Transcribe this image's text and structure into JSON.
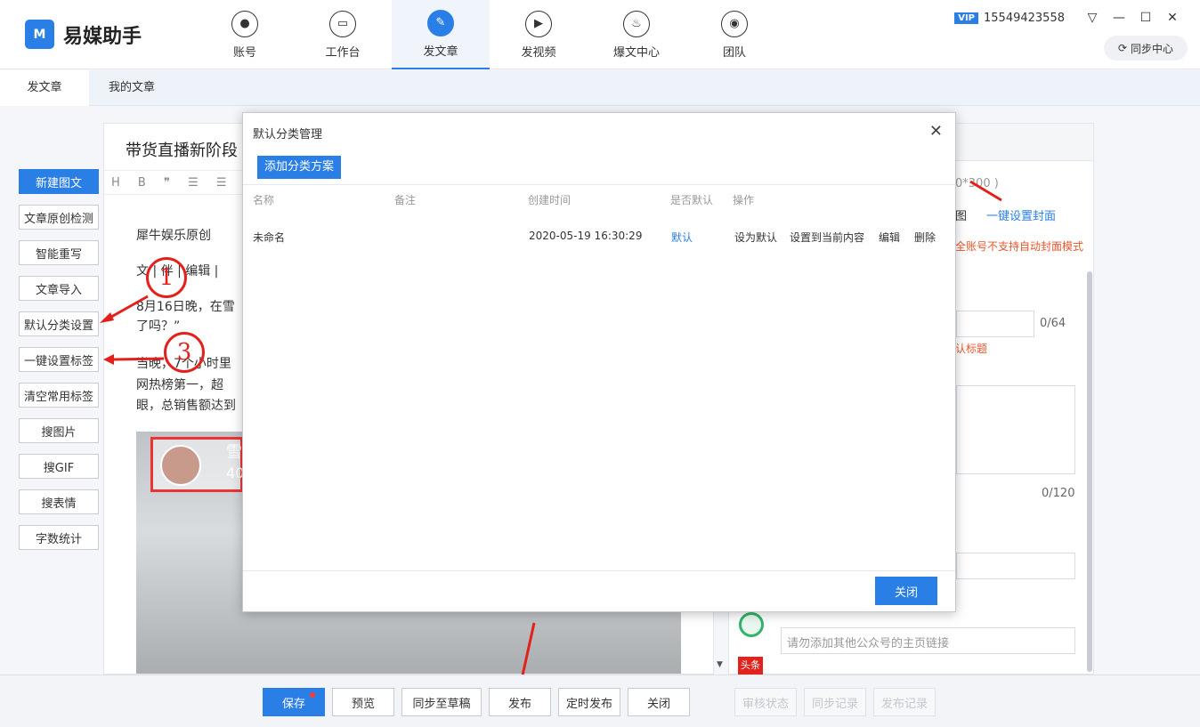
{
  "app": {
    "name": "易媒助手",
    "logo_glyph": "M"
  },
  "nav": [
    {
      "label": "账号",
      "icon": "person-icon",
      "glyph": "●"
    },
    {
      "label": "工作台",
      "icon": "monitor-icon",
      "glyph": "▭"
    },
    {
      "label": "发文章",
      "icon": "feather-icon",
      "glyph": "✎"
    },
    {
      "label": "发视频",
      "icon": "play-icon",
      "glyph": "▶"
    },
    {
      "label": "爆文中心",
      "icon": "flame-icon",
      "glyph": "♨"
    },
    {
      "label": "团队",
      "icon": "team-icon",
      "glyph": "◉"
    }
  ],
  "user": {
    "vip": "VIP",
    "phone": "15549423558"
  },
  "sync_center": "同步中心",
  "subtabs": [
    "发文章",
    "我的文章"
  ],
  "left_buttons": [
    "新建图文",
    "文章原创检测",
    "智能重写",
    "文章导入",
    "默认分类设置",
    "一键设置标签",
    "清空常用标签",
    "搜图片",
    "搜GIF",
    "搜表情",
    "字数统计"
  ],
  "editor": {
    "title": "带货直播新阶段",
    "toolbar": "H B ❞ ☰ ☰ —",
    "lines": [
      "犀牛娱乐原创",
      "文 | 伴 | 编辑 | ",
      "8月16日晚，在雪",
      "了吗？”",
      "当晚，7个小时里",
      "网热榜第一，超",
      "眼，总销售额达到"
    ],
    "image_text": [
      "雪",
      "40"
    ]
  },
  "right_panel": {
    "size_hint": "0*300 )",
    "cover_link": "一键设置封面",
    "cover_note": "全账号不支持自动封面模式",
    "title_count": "0/64",
    "title_hint": "认标题",
    "abstract_count": "0/120",
    "link_placeholder": "请勿添加其他公众号的主页链接",
    "tu": "图"
  },
  "modal": {
    "title": "默认分类管理",
    "add_button": "添加分类方案",
    "columns": [
      "名称",
      "备注",
      "创建时间",
      "是否默认",
      "操作"
    ],
    "rows": [
      {
        "name": "未命名",
        "note": "",
        "created": "2020-05-19 16:30:29",
        "is_default": "默认",
        "ops": [
          "设为默认",
          "设置到当前内容",
          "编辑",
          "删除"
        ]
      }
    ],
    "close_button": "关闭"
  },
  "bottom": {
    "save": "保存",
    "preview": "预览",
    "sync_draft": "同步至草稿",
    "publish": "发布",
    "schedule": "定时发布",
    "close": "关闭",
    "audit": "审核状态",
    "sync_log": "同步记录",
    "publish_log": "发布记录"
  },
  "annotations": [
    "1",
    "3"
  ],
  "colors": {
    "accent": "#2a7fe6",
    "annotation": "#e3211c",
    "warn": "#e8572c"
  }
}
